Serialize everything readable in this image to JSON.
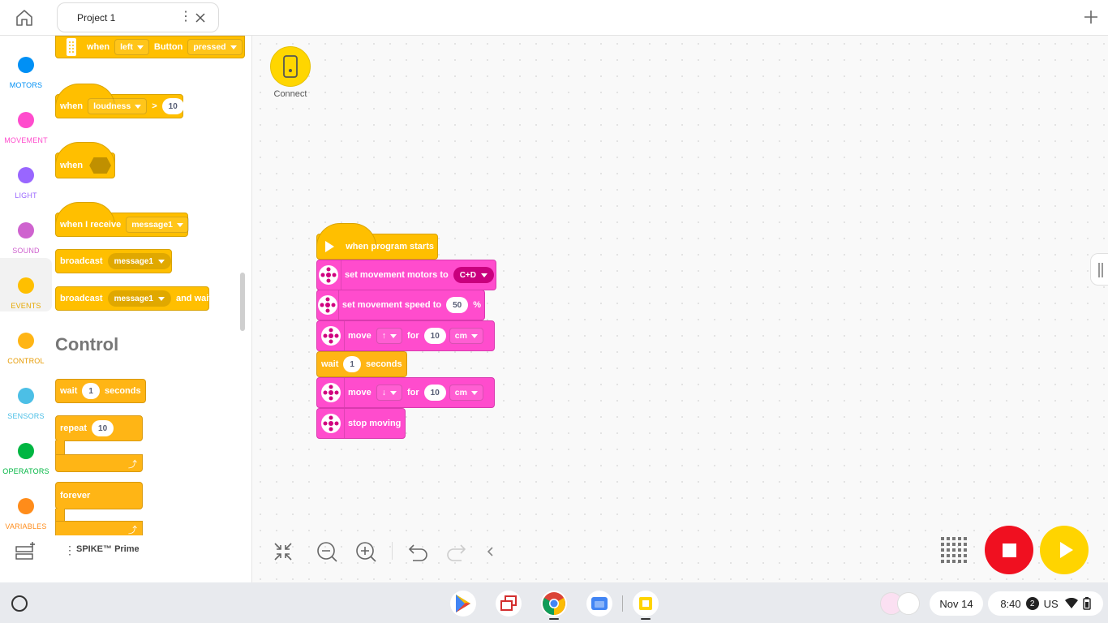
{
  "window": {
    "tab_title": "Project 1"
  },
  "categories": [
    {
      "label": "MOTORS",
      "color": "#0090f5",
      "text_color": "#0090f5"
    },
    {
      "label": "MOVEMENT",
      "color": "#ff4ccd",
      "text_color": "#ff4ccd"
    },
    {
      "label": "LIGHT",
      "color": "#9966ff",
      "text_color": "#9966ff"
    },
    {
      "label": "SOUND",
      "color": "#cf63cf",
      "text_color": "#cf63cf"
    },
    {
      "label": "EVENTS",
      "color": "#ffbf00",
      "text_color": "#e6a800"
    },
    {
      "label": "CONTROL",
      "color": "#ffb515",
      "text_color": "#e69a00"
    },
    {
      "label": "SENSORS",
      "color": "#4cbfe6",
      "text_color": "#4cbfe6"
    },
    {
      "label": "OPERATORS",
      "color": "#00b642",
      "text_color": "#00b642"
    },
    {
      "label": "VARIABLES",
      "color": "#ff8c1a",
      "text_color": "#ff8c1a"
    }
  ],
  "palette": {
    "button_block": {
      "when": "when",
      "side": "left",
      "button": "Button",
      "state": "pressed"
    },
    "loudness_block": {
      "when": "when",
      "sensor": "loudness",
      "op": ">",
      "value": "10"
    },
    "when_block": {
      "when": "when"
    },
    "receive_block": {
      "text": "when I receive",
      "message": "message1"
    },
    "broadcast_block": {
      "text": "broadcast",
      "message": "message1"
    },
    "broadcast_wait_block": {
      "text": "broadcast",
      "message": "message1",
      "suffix": "and wait"
    },
    "control_heading": "Control",
    "wait_block": {
      "text": "wait",
      "value": "1",
      "suffix": "seconds"
    },
    "repeat_block": {
      "text": "repeat",
      "value": "10"
    },
    "forever_block": {
      "text": "forever"
    },
    "footer_name": "SPIKE™ Prime"
  },
  "canvas": {
    "connect_label": "Connect",
    "script": {
      "start": "when program starts",
      "set_motors": {
        "text": "set movement motors to",
        "value": "C+D"
      },
      "set_speed": {
        "text": "set movement speed to",
        "value": "50",
        "unit": "%"
      },
      "move1": {
        "text": "move",
        "for": "for",
        "value": "10",
        "unit": "cm"
      },
      "wait": {
        "text": "wait",
        "value": "1",
        "suffix": "seconds"
      },
      "move2": {
        "text": "move",
        "for": "for",
        "value": "10",
        "unit": "cm"
      },
      "stop": "stop moving"
    }
  },
  "shelf": {
    "date": "Nov 14",
    "time": "8:40",
    "notif_count": "2",
    "locale": "US"
  }
}
